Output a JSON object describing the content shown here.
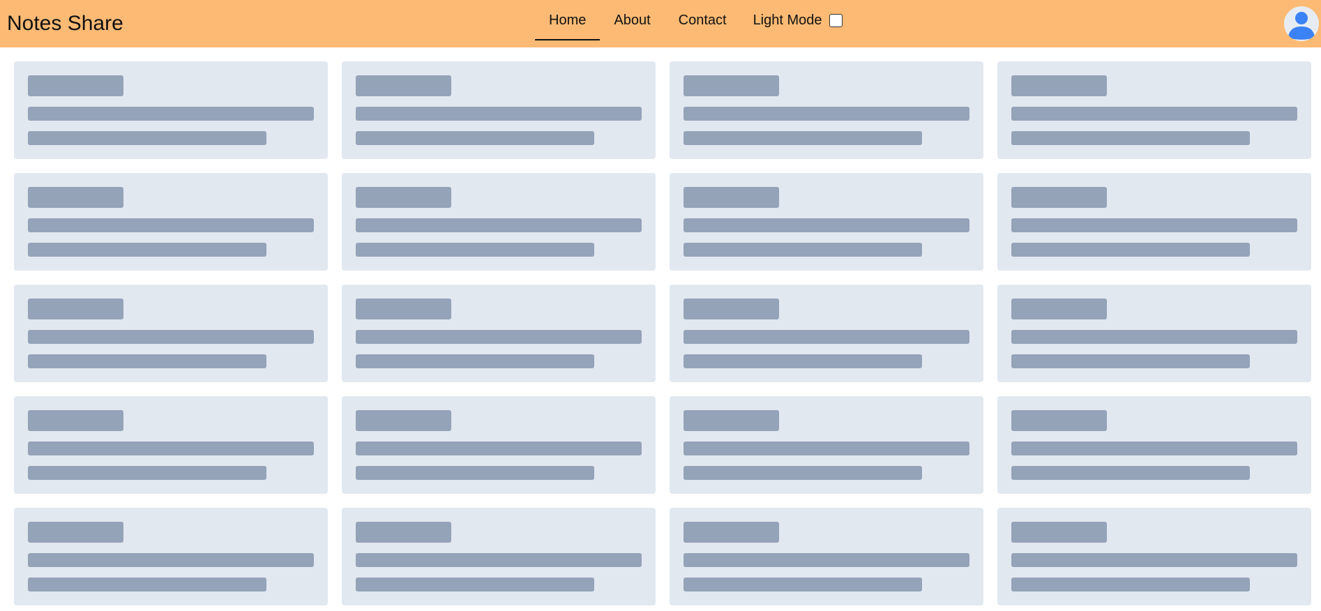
{
  "header": {
    "brand": "Notes Share",
    "nav": [
      {
        "label": "Home",
        "active": true
      },
      {
        "label": "About",
        "active": false
      },
      {
        "label": "Contact",
        "active": false
      }
    ],
    "theme_toggle_label": "Light Mode",
    "theme_toggle_checked": false,
    "avatar_icon": "user-avatar-icon"
  },
  "colors": {
    "navbar_bg": "#fdba74",
    "card_bg": "#e2e8f0",
    "skeleton": "#94a3b8",
    "avatar_blue": "#3b82f6"
  },
  "notes_grid": {
    "state": "loading-skeleton",
    "columns": 4,
    "rows": 5,
    "card_count": 20
  }
}
